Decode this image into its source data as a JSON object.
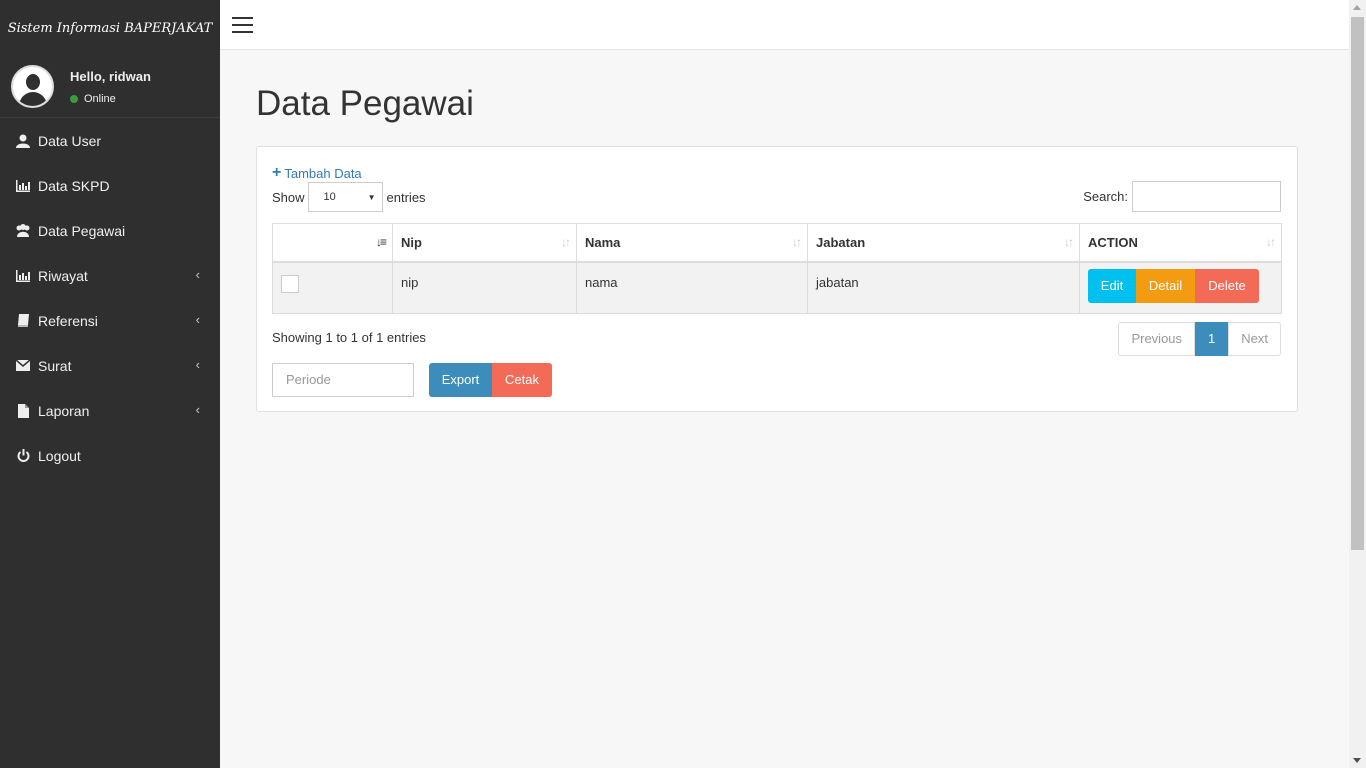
{
  "app": {
    "title": "Sistem Informasi BAPERJAKAT"
  },
  "user": {
    "greeting": "Hello, ridwan",
    "status": "Online"
  },
  "sidebar": {
    "items": [
      {
        "label": "Data User",
        "icon": "user-icon"
      },
      {
        "label": "Data SKPD",
        "icon": "bar-chart-icon"
      },
      {
        "label": "Data Pegawai",
        "icon": "users-icon"
      },
      {
        "label": "Riwayat",
        "icon": "bar-chart-icon",
        "submenu": true
      },
      {
        "label": "Referensi",
        "icon": "book-icon",
        "submenu": true
      },
      {
        "label": "Surat",
        "icon": "envelope-icon",
        "submenu": true
      },
      {
        "label": "Laporan",
        "icon": "file-icon",
        "submenu": true
      },
      {
        "label": "Logout",
        "icon": "power-icon"
      }
    ]
  },
  "page": {
    "title": "Data Pegawai"
  },
  "panel": {
    "add_label": "Tambah Data",
    "show_label": "Show",
    "entries_value": "10",
    "entries_label": "entries",
    "search_label": "Search:",
    "columns": [
      "Nip",
      "Nama",
      "Jabatan",
      "ACTION"
    ],
    "rows": [
      {
        "nip": "nip",
        "nama": "nama",
        "jabatan": "jabatan"
      }
    ],
    "actions": {
      "edit": "Edit",
      "detail": "Detail",
      "delete": "Delete"
    },
    "info": "Showing 1 to 1 of 1 entries",
    "pager": {
      "prev": "Previous",
      "current": "1",
      "next": "Next"
    },
    "periode_placeholder": "Periode",
    "export_label": "Export",
    "cetak_label": "Cetak"
  },
  "colors": {
    "sidebar_bg": "#2f2f2f",
    "primary": "#3c8dbc",
    "info": "#00c0ef",
    "warning": "#f39c12",
    "danger": "#f36a56",
    "online": "#3c9c3c"
  }
}
